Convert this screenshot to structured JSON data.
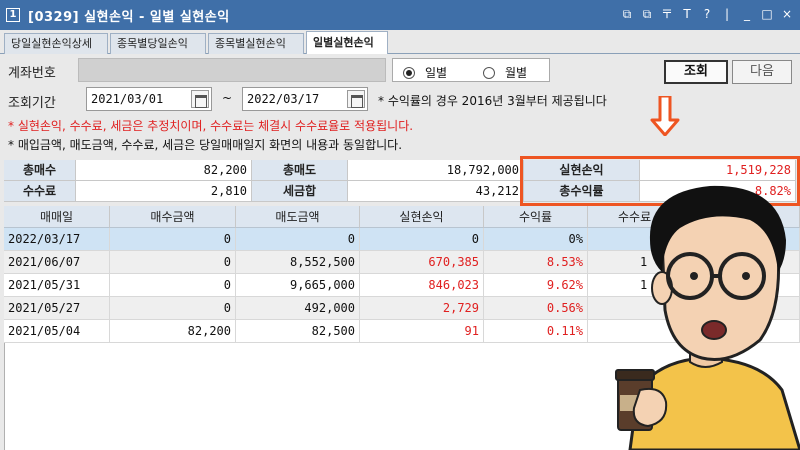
{
  "window": {
    "title": "[0329] 실현손익 - 일별 실현손익",
    "icon": "1",
    "controls": [
      "⧉",
      "⧉",
      "〒",
      "T",
      "?",
      "|",
      "_",
      "□",
      "×"
    ]
  },
  "tabs": [
    {
      "label": "당일실현손익상세"
    },
    {
      "label": "종목별당일손익"
    },
    {
      "label": "종목별실현손익"
    },
    {
      "label": "일별실현손익"
    }
  ],
  "account": {
    "label": "계좌번호",
    "value": ""
  },
  "period_type": {
    "options": [
      "일별",
      "월별"
    ],
    "selected": "일별"
  },
  "buttons": {
    "query": "조회",
    "next": "다음"
  },
  "period": {
    "label": "조회기간",
    "start": "2021/03/01",
    "tilde": "~",
    "end": "2022/03/17"
  },
  "notes": {
    "yield_note": "* 수익률의 경우 2016년 3월부터 제공됩니다",
    "estimate_note": "* 실현손익, 수수료, 세금은 추정치이며, 수수료는 체결시 수수료율로 적용됩니다.",
    "sync_note": "* 매입금액, 매도금액, 수수료, 세금은 당일매매일지 화면의 내용과 동일합니다."
  },
  "summary": {
    "total_buy_label": "총매수",
    "total_buy": "82,200",
    "total_sell_label": "총매도",
    "total_sell": "18,792,000",
    "realized_label": "실현손익",
    "realized": "1,519,228",
    "fee_label": "수수료",
    "fee": "2,810",
    "tax_label": "세금합",
    "tax": "43,212",
    "total_yield_label": "총수익률",
    "total_yield": "8.82%"
  },
  "table": {
    "headers": [
      "매매일",
      "매수금액",
      "매도금액",
      "실현손익",
      "수익률",
      "수수료"
    ],
    "rows": [
      {
        "date": "2022/03/17",
        "buy": "0",
        "sell": "0",
        "pnl": "0",
        "yield": "0%",
        "fee": ""
      },
      {
        "date": "2021/06/07",
        "buy": "0",
        "sell": "8,552,500",
        "pnl": "670,385",
        "yield": "8.53%",
        "fee": "1"
      },
      {
        "date": "2021/05/31",
        "buy": "0",
        "sell": "9,665,000",
        "pnl": "846,023",
        "yield": "9.62%",
        "fee": "1"
      },
      {
        "date": "2021/05/27",
        "buy": "0",
        "sell": "492,000",
        "pnl": "2,729",
        "yield": "0.56%",
        "fee": ""
      },
      {
        "date": "2021/05/04",
        "buy": "82,200",
        "sell": "82,500",
        "pnl": "91",
        "yield": "0.11%",
        "fee": ""
      }
    ]
  },
  "colors": {
    "accent": "#3f6fa8",
    "highlight": "#ee5522",
    "profit": "#e02020"
  }
}
